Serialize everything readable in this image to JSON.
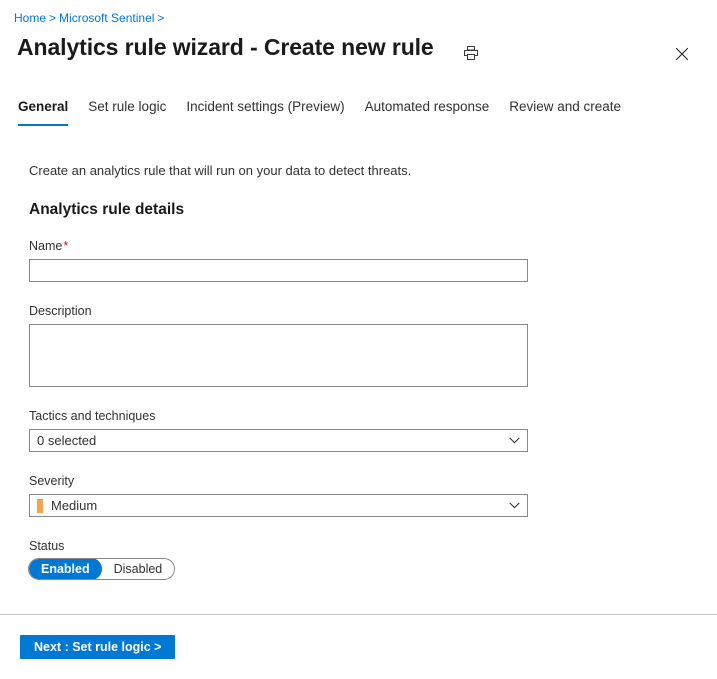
{
  "breadcrumb": {
    "items": [
      "Home",
      "Microsoft Sentinel"
    ],
    "separator": ">",
    "trailing_separator": ">"
  },
  "header": {
    "title": "Analytics rule wizard - Create new rule",
    "print_icon": "print-icon",
    "close_icon": "close-icon"
  },
  "tabs": [
    {
      "label": "General",
      "active": true
    },
    {
      "label": "Set rule logic",
      "active": false
    },
    {
      "label": "Incident settings (Preview)",
      "active": false
    },
    {
      "label": "Automated response",
      "active": false
    },
    {
      "label": "Review and create",
      "active": false
    }
  ],
  "main": {
    "intro": "Create an analytics rule that will run on your data to detect threats.",
    "section_heading": "Analytics rule details",
    "fields": {
      "name": {
        "label": "Name",
        "required_marker": "*",
        "value": "",
        "placeholder": ""
      },
      "description": {
        "label": "Description",
        "value": "",
        "placeholder": ""
      },
      "tactics": {
        "label": "Tactics and techniques",
        "value": "0 selected",
        "chevron_icon": "chevron-down-icon"
      },
      "severity": {
        "label": "Severity",
        "value": "Medium",
        "swatch_color": "#f7a34c",
        "chevron_icon": "chevron-down-icon"
      },
      "status": {
        "label": "Status",
        "options": [
          "Enabled",
          "Disabled"
        ],
        "selected": "Enabled"
      }
    }
  },
  "footer": {
    "next_label": "Next : Set rule logic >"
  },
  "colors": {
    "accent": "#0078d4",
    "severity_medium": "#f7a34c",
    "required": "#a4262c",
    "border": "#8a8886",
    "divider": "#c8c6c4"
  }
}
